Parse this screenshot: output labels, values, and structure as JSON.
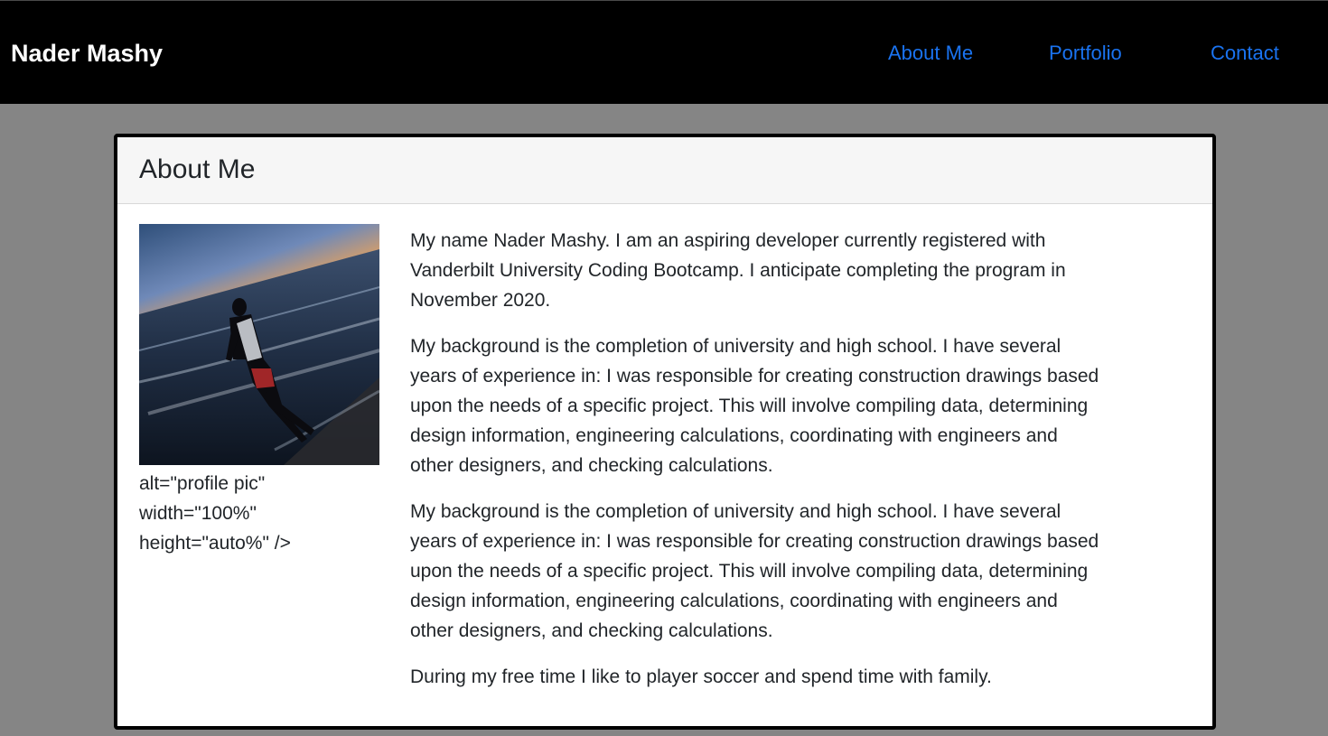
{
  "nav": {
    "brand": "Nader Mashy",
    "links": [
      "About Me",
      "Portfolio",
      "Contact"
    ]
  },
  "colors": {
    "navbar_bg": "#000000",
    "page_bg": "#858585",
    "link": "#1a73f0",
    "card_header_bg": "#f6f6f6"
  },
  "card": {
    "title": "About Me",
    "image": {
      "icon": "profile-photo-beach-sunset",
      "alt_text_lines": [
        "alt=\"profile pic\"",
        "width=\"100%\"",
        "height=\"auto%\" />"
      ]
    },
    "paragraphs": [
      "My name Nader Mashy. I am an aspiring developer currently registered with Vanderbilt University Coding Bootcamp. I anticipate completing the program in November 2020.",
      "My background is the completion of university and high school. I have several years of experience in: I was responsible for creating construction drawings based upon the needs of a specific project. This will involve compiling data, determining design information, engineering calculations, coordinating with engineers and other designers, and checking calculations.",
      "My background is the completion of university and high school. I have several years of experience in: I was responsible for creating construction drawings based upon the needs of a specific project. This will involve compiling data, determining design information, engineering calculations, coordinating with engineers and other designers, and checking calculations.",
      "During my free time I like to player soccer and spend time with family."
    ]
  }
}
